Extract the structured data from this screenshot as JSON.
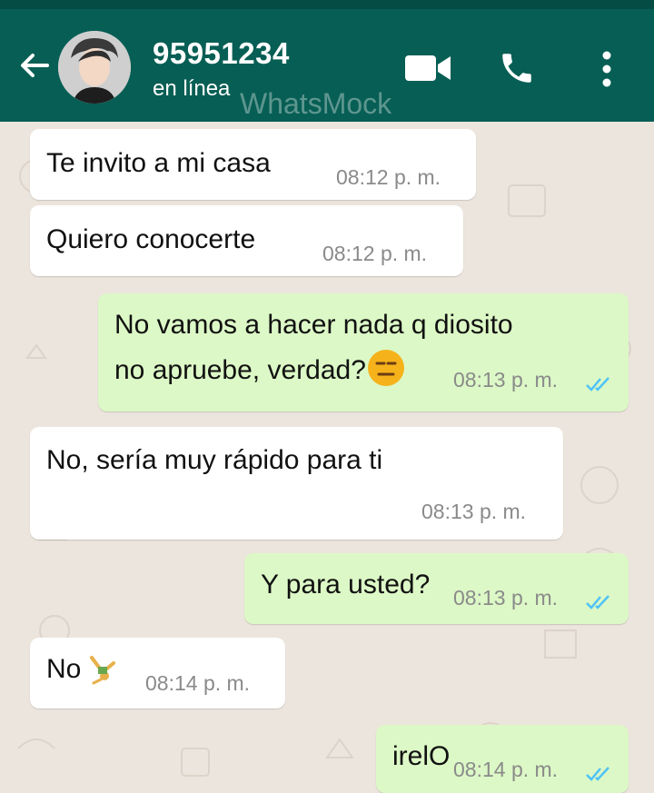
{
  "header": {
    "title": "95951234",
    "status": "en línea",
    "watermark": "WhatsMock",
    "back_icon": "arrow-left-icon",
    "video_icon": "video-camera-icon",
    "call_icon": "phone-icon",
    "menu_icon": "more-vertical-icon"
  },
  "colors": {
    "header": "#075e54",
    "incoming": "#ffffff",
    "outgoing": "#dcf8c6",
    "read_ticks": "#4fc3f7"
  },
  "messages": [
    {
      "dir": "in",
      "text": "Te invito a mi casa",
      "time": "08:12 p. m."
    },
    {
      "dir": "in",
      "text": "Quiero conocerte",
      "time": "08:12 p. m."
    },
    {
      "dir": "out",
      "line1": "No vamos a hacer nada q diosito",
      "line2": "no apruebe, verdad?",
      "emoji": "expressionless-face-emoji",
      "time": "08:13 p. m.",
      "status": "read"
    },
    {
      "dir": "in",
      "text": "No, sería muy rápido para ti",
      "time": "08:13 p. m."
    },
    {
      "dir": "out",
      "text": "Y para usted?",
      "time": "08:13 p. m.",
      "status": "read"
    },
    {
      "dir": "in",
      "text": "No",
      "emoji": "person-cartwheeling-emoji",
      "time": "08:14 p. m."
    },
    {
      "dir": "out",
      "text": "irelO",
      "time": "08:14 p. m.",
      "status": "read"
    }
  ]
}
